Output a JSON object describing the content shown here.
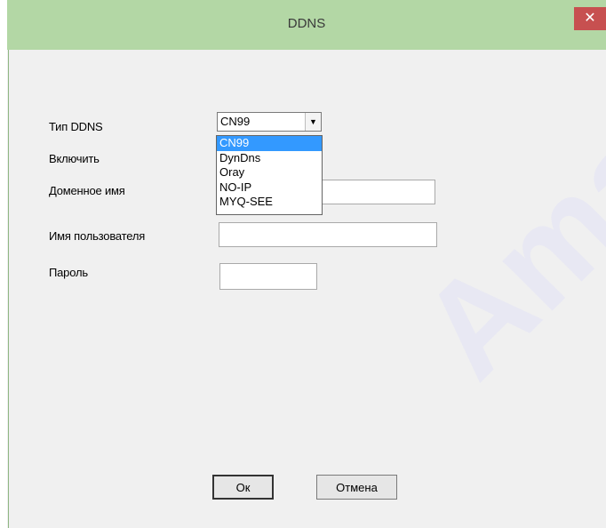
{
  "window": {
    "title": "DDNS",
    "close_glyph": "✕"
  },
  "form": {
    "type_label": "Тип DDNS",
    "enable_label": "Включить",
    "domain_label": "Доменное имя",
    "username_label": "Имя пользователя",
    "password_label": "Пароль",
    "type_selected": "CN99",
    "domain_value": "",
    "username_value": "",
    "password_value": ""
  },
  "dropdown": {
    "options": [
      "CN99",
      "DynDns",
      "Oray",
      "NO-IP",
      "MYQ-SEE"
    ],
    "highlighted_index": 0
  },
  "buttons": {
    "ok": "Ок",
    "cancel": "Отмена"
  },
  "colors": {
    "titlebar": "#b3d7a5",
    "close": "#c75050",
    "selection": "#3399ff"
  },
  "watermark": "Ama"
}
